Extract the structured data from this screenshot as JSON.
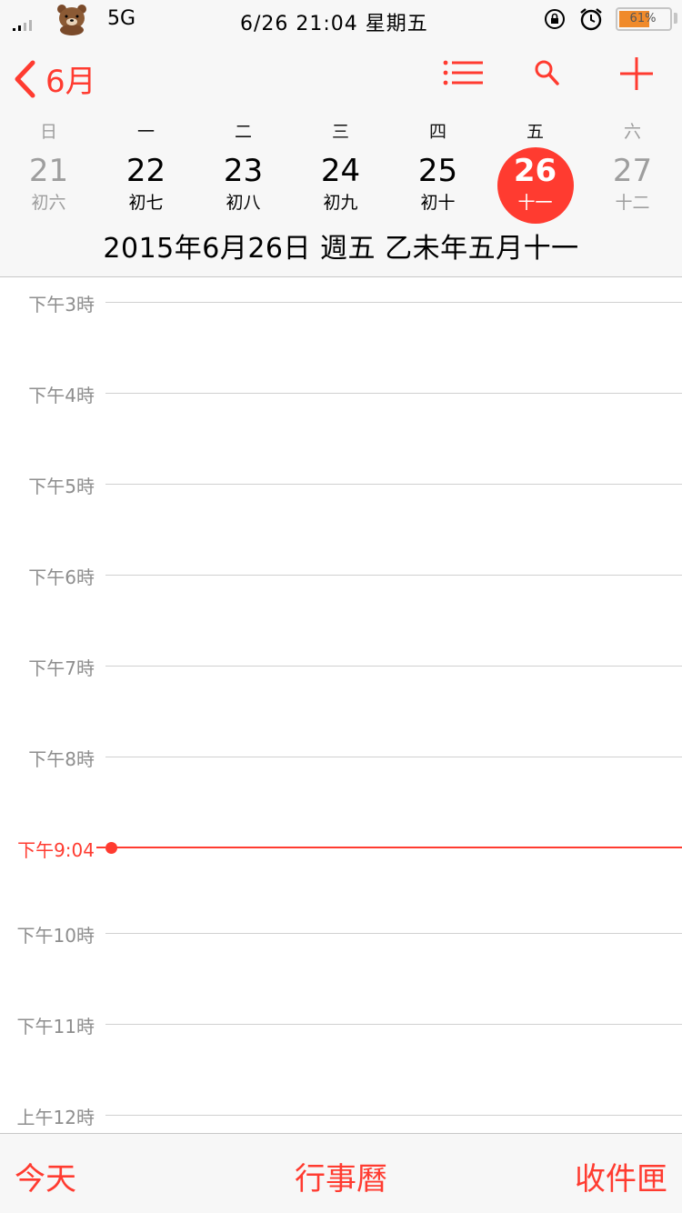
{
  "status_bar": {
    "network": "5G",
    "clock": "6/26 21:04 星期五",
    "battery": "61%",
    "battery_level": 0.61
  },
  "nav": {
    "back_label": "6月",
    "icons": [
      "list-icon",
      "search-icon",
      "add-icon"
    ]
  },
  "week": [
    {
      "weekday": "日",
      "day": "21",
      "lunar": "初六"
    },
    {
      "weekday": "一",
      "day": "22",
      "lunar": "初七"
    },
    {
      "weekday": "二",
      "day": "23",
      "lunar": "初八"
    },
    {
      "weekday": "三",
      "day": "24",
      "lunar": "初九"
    },
    {
      "weekday": "四",
      "day": "25",
      "lunar": "初十"
    },
    {
      "weekday": "五",
      "day": "26",
      "lunar": "十一"
    },
    {
      "weekday": "六",
      "day": "27",
      "lunar": "十二"
    }
  ],
  "full_date": "2015年6月26日 週五  乙未年五月十一",
  "hours": [
    "下午3時",
    "下午4時",
    "下午5時",
    "下午6時",
    "下午7時",
    "下午8時",
    "下午9:04",
    "下午10時",
    "下午11時",
    "上午12時"
  ],
  "tabs": {
    "today": "今天",
    "calendars": "行事曆",
    "inbox": "收件匣"
  },
  "colors": {
    "accent": "#ff3b30",
    "battery": "#f08a2a",
    "muted": "#8e8e8e"
  }
}
